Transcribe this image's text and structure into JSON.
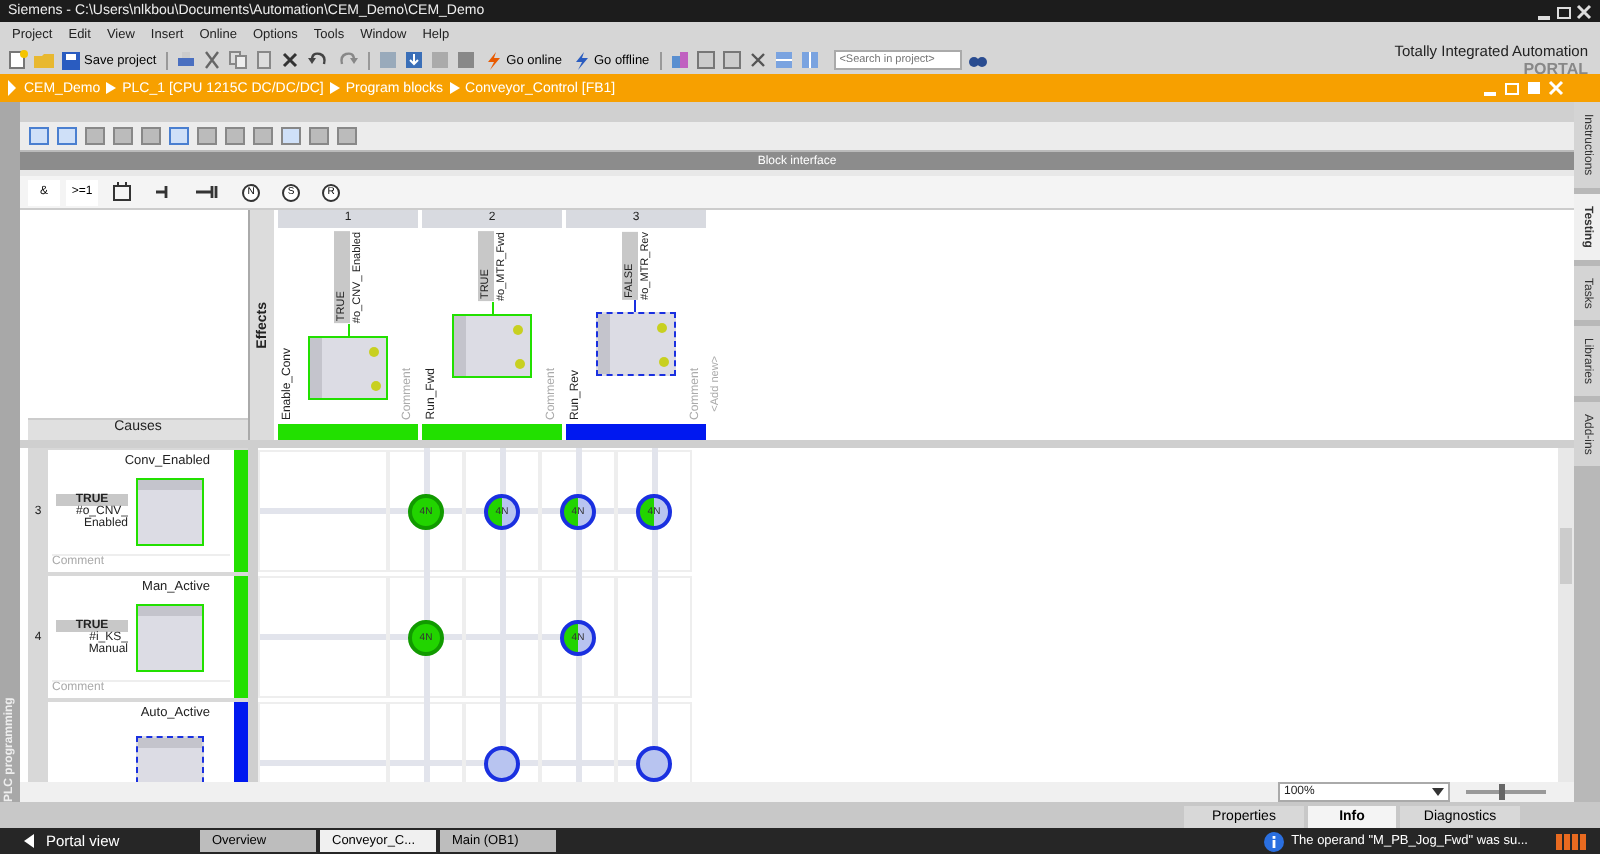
{
  "window": {
    "title": "Siemens  -  C:\\Users\\nlkbou\\Documents\\Automation\\CEM_Demo\\CEM_Demo"
  },
  "menu": [
    "Project",
    "Edit",
    "View",
    "Insert",
    "Online",
    "Options",
    "Tools",
    "Window",
    "Help"
  ],
  "toolbar": {
    "save_label": "Save project",
    "go_online": "Go online",
    "go_offline": "Go offline",
    "search": {
      "placeholder": "<Search in project>"
    }
  },
  "branding": {
    "line1": "Totally Integrated Automation",
    "line2": "PORTAL"
  },
  "breadcrumb": [
    "CEM_Demo",
    "PLC_1 [CPU 1215C DC/DC/DC]",
    "Program blocks",
    "Conveyor_Control [FB1]"
  ],
  "left_tab": "PLC programming",
  "right_tabs": [
    {
      "label": "Instructions",
      "selected": false
    },
    {
      "label": "Testing",
      "selected": true
    },
    {
      "label": "Tasks",
      "selected": false
    },
    {
      "label": "Libraries",
      "selected": false
    },
    {
      "label": "Add-ins",
      "selected": false
    }
  ],
  "block_interface": "Block interface",
  "palette": [
    {
      "kind": "text",
      "label": "&"
    },
    {
      "kind": "text",
      "label": ">=1"
    },
    {
      "kind": "box"
    },
    {
      "kind": "contact"
    },
    {
      "kind": "contact-long"
    },
    {
      "kind": "coil",
      "label": "N"
    },
    {
      "kind": "coil",
      "label": "S"
    },
    {
      "kind": "coil",
      "label": "R"
    }
  ],
  "effects": {
    "title": "Effects",
    "add_new": "<Add new>",
    "columns": [
      {
        "number": "1",
        "value": "TRUE",
        "operand": "#o_CNV_ Enabled",
        "name": "Enable_Conv",
        "comment": "Comment",
        "active": true
      },
      {
        "number": "2",
        "value": "TRUE",
        "operand": "#o_MTR_Fwd",
        "name": "Run_Fwd",
        "comment": "Comment",
        "active": true
      },
      {
        "number": "3",
        "value": "FALSE",
        "operand": "#o_MTR_Rev",
        "name": "Run_Rev",
        "comment": "Comment",
        "active": false
      }
    ]
  },
  "causes": {
    "title": "Causes",
    "rows": [
      {
        "number": "3",
        "name": "Conv_Enabled",
        "value": "TRUE",
        "operand": "#o_CNV_ Enabled",
        "comment": "Comment",
        "active": true,
        "cells": [
          {
            "kind": "none"
          },
          {
            "kind": "true",
            "label": "4N"
          },
          {
            "kind": "mixed",
            "label": "4N"
          },
          {
            "kind": "mixed",
            "label": "4N"
          },
          {
            "kind": "mixed",
            "label": "4N"
          }
        ]
      },
      {
        "number": "4",
        "name": "Man_Active",
        "value": "TRUE",
        "operand": "#i_KS_ Manual",
        "comment": "Comment",
        "active": true,
        "cells": [
          {
            "kind": "none"
          },
          {
            "kind": "true",
            "label": "4N"
          },
          {
            "kind": "none"
          },
          {
            "kind": "mixed",
            "label": "4N"
          },
          {
            "kind": "none"
          }
        ]
      },
      {
        "name": "Auto_Active",
        "active": false,
        "cells": [
          {
            "kind": "none"
          },
          {
            "kind": "none"
          },
          {
            "kind": "false"
          },
          {
            "kind": "none"
          },
          {
            "kind": "false"
          }
        ]
      }
    ]
  },
  "zoom": {
    "value": "100%",
    "slider": {
      "level": 0.45
    }
  },
  "inspector_tabs": [
    {
      "label": "Properties",
      "selected": false
    },
    {
      "label": "Info",
      "selected": true
    },
    {
      "label": "Diagnostics",
      "selected": false
    }
  ],
  "taskbar": {
    "portal_view": "Portal view",
    "editors": [
      {
        "label": "Overview",
        "selected": false
      },
      {
        "label": "Conveyor_C...",
        "selected": true
      },
      {
        "label": "Main (OB1)",
        "selected": false
      }
    ],
    "message": "The operand \"M_PB_Jog_Fwd\" was su..."
  }
}
